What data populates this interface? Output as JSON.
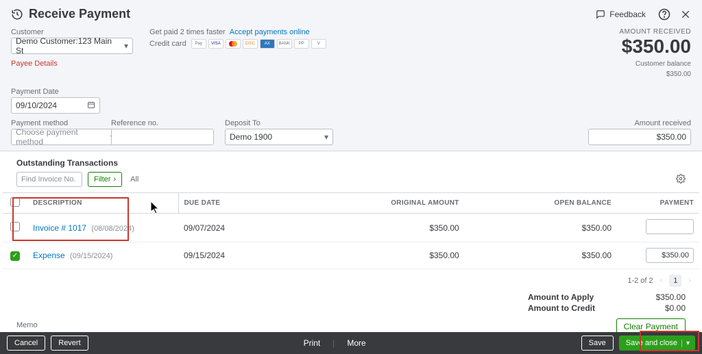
{
  "header": {
    "title": "Receive Payment",
    "feedback": "Feedback"
  },
  "customer": {
    "label": "Customer",
    "value": "Demo Customer:123 Main St",
    "payee_details": "Payee Details"
  },
  "promo": {
    "line1": "Get paid 2 times faster",
    "link": "Accept payments online",
    "credit_card_label": "Credit card"
  },
  "amount_received_box": {
    "label": "AMOUNT RECEIVED",
    "value": "$350.00",
    "balance_label": "Customer balance",
    "balance_value": "$350.00"
  },
  "payment_date": {
    "label": "Payment Date",
    "value": "09/10/2024"
  },
  "payment_method": {
    "label": "Payment method",
    "placeholder": "Choose payment method"
  },
  "reference_no": {
    "label": "Reference no."
  },
  "deposit_to": {
    "label": "Deposit To",
    "value": "Demo 1900"
  },
  "amount_received_field": {
    "label": "Amount received",
    "value": "$350.00"
  },
  "transactions": {
    "heading": "Outstanding Transactions",
    "search_placeholder": "Find Invoice No.",
    "filter": "Filter",
    "all": "All",
    "columns": {
      "description": "DESCRIPTION",
      "due_date": "DUE DATE",
      "original_amount": "ORIGINAL AMOUNT",
      "open_balance": "OPEN BALANCE",
      "payment": "PAYMENT"
    },
    "rows": [
      {
        "checked": false,
        "desc_link": "Invoice # 1017",
        "desc_date": "(08/08/2024)",
        "due_date": "09/07/2024",
        "original_amount": "$350.00",
        "open_balance": "$350.00",
        "payment": ""
      },
      {
        "checked": true,
        "desc_link": "Expense",
        "desc_date": "(09/15/2024)",
        "due_date": "09/15/2024",
        "original_amount": "$350.00",
        "open_balance": "$350.00",
        "payment": "$350.00"
      }
    ]
  },
  "pager": {
    "range": "1-2 of 2",
    "page": "1"
  },
  "totals": {
    "apply_label": "Amount to Apply",
    "apply_value": "$350.00",
    "credit_label": "Amount to Credit",
    "credit_value": "$0.00",
    "clear": "Clear Payment"
  },
  "memo_label": "Memo",
  "footer": {
    "cancel": "Cancel",
    "revert": "Revert",
    "print": "Print",
    "more": "More",
    "save": "Save",
    "save_close": "Save and close"
  }
}
